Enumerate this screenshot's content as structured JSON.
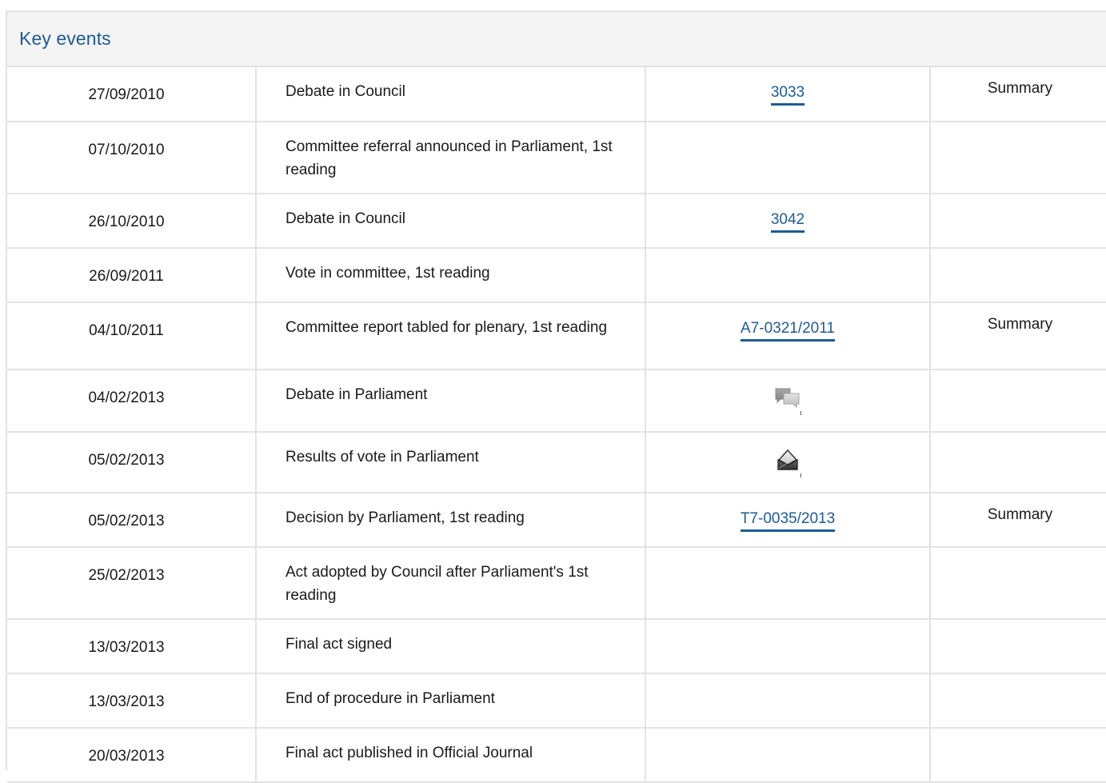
{
  "panel": {
    "title": "Key events"
  },
  "rows": [
    {
      "date": "27/09/2010",
      "event": "Debate in Council",
      "ref": "3033",
      "ref_type": "link",
      "summary": "Summary"
    },
    {
      "date": "07/10/2010",
      "event": "Committee referral announced in Parliament, 1st reading",
      "ref": "",
      "ref_type": "none",
      "summary": ""
    },
    {
      "date": "26/10/2010",
      "event": "Debate in Council",
      "ref": "3042",
      "ref_type": "link",
      "summary": ""
    },
    {
      "date": "26/09/2011",
      "event": "Vote in committee, 1st reading",
      "ref": "",
      "ref_type": "none",
      "summary": ""
    },
    {
      "date": "04/10/2011",
      "event": "Committee report tabled for plenary, 1st reading",
      "ref": "A7-0321/2011",
      "ref_type": "link",
      "summary": "Summary"
    },
    {
      "date": "04/02/2013",
      "event": "Debate in Parliament",
      "ref": "",
      "ref_type": "debate-icon",
      "summary": ""
    },
    {
      "date": "05/02/2013",
      "event": "Results of vote in Parliament",
      "ref": "",
      "ref_type": "vote-icon",
      "summary": ""
    },
    {
      "date": "05/02/2013",
      "event": "Decision by Parliament, 1st reading",
      "ref": "T7-0035/2013",
      "ref_type": "link",
      "summary": "Summary"
    },
    {
      "date": "25/02/2013",
      "event": "Act adopted by Council after Parliament's 1st reading",
      "ref": "",
      "ref_type": "none",
      "summary": ""
    },
    {
      "date": "13/03/2013",
      "event": "Final act signed",
      "ref": "",
      "ref_type": "none",
      "summary": ""
    },
    {
      "date": "13/03/2013",
      "event": "End of procedure in Parliament",
      "ref": "",
      "ref_type": "none",
      "summary": ""
    },
    {
      "date": "20/03/2013",
      "event": "Final act published in Official Journal",
      "ref": "",
      "ref_type": "none",
      "summary": ""
    }
  ],
  "colors": {
    "link": "#1d5b95",
    "border": "#e3e3e3",
    "header_bg": "#f4f4f4"
  }
}
